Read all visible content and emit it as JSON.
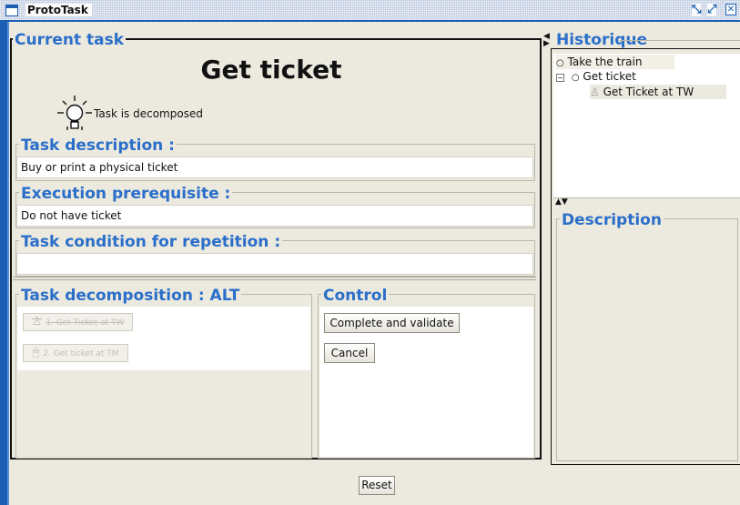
{
  "window": {
    "title": "ProtoTask",
    "controls": [
      "minimize-icon",
      "maximize-icon",
      "close-icon"
    ]
  },
  "current_task": {
    "legend": "Current task",
    "title": "Get ticket",
    "status_icon": "lightbulb-icon",
    "status_text": "Task is decomposed",
    "description": {
      "legend": "Task description :",
      "value": "Buy or print a physical ticket"
    },
    "prerequisite": {
      "legend": "Execution prerequisite :",
      "value": "Do not have ticket"
    },
    "repetition": {
      "legend": "Task condition for repetition :",
      "value": ""
    }
  },
  "decomposition": {
    "legend": "Task decomposition : ALT",
    "items": [
      {
        "label": "1. Get Ticket at TW",
        "icon": "person-icon",
        "disabled": true
      },
      {
        "label": "2. Get ticket at TM",
        "icon": "mouse-icon",
        "disabled": true
      }
    ]
  },
  "control": {
    "legend": "Control",
    "complete_label": "Complete and validate",
    "cancel_label": "Cancel"
  },
  "historique": {
    "legend": "Historique",
    "tree": [
      {
        "label": "Take the train",
        "icon": "lightbulb-icon",
        "level": 0
      },
      {
        "label": "Get ticket",
        "icon": "lightbulb-icon",
        "level": 1,
        "expanded": true
      },
      {
        "label": "Get Ticket at TW",
        "icon": "person-icon",
        "level": 2
      }
    ]
  },
  "description_panel": {
    "legend": "Description"
  },
  "reset_label": "Reset",
  "colors": {
    "legend": "#2a6fc9",
    "frame": "#1a5fb4",
    "background": "#ece9df"
  }
}
